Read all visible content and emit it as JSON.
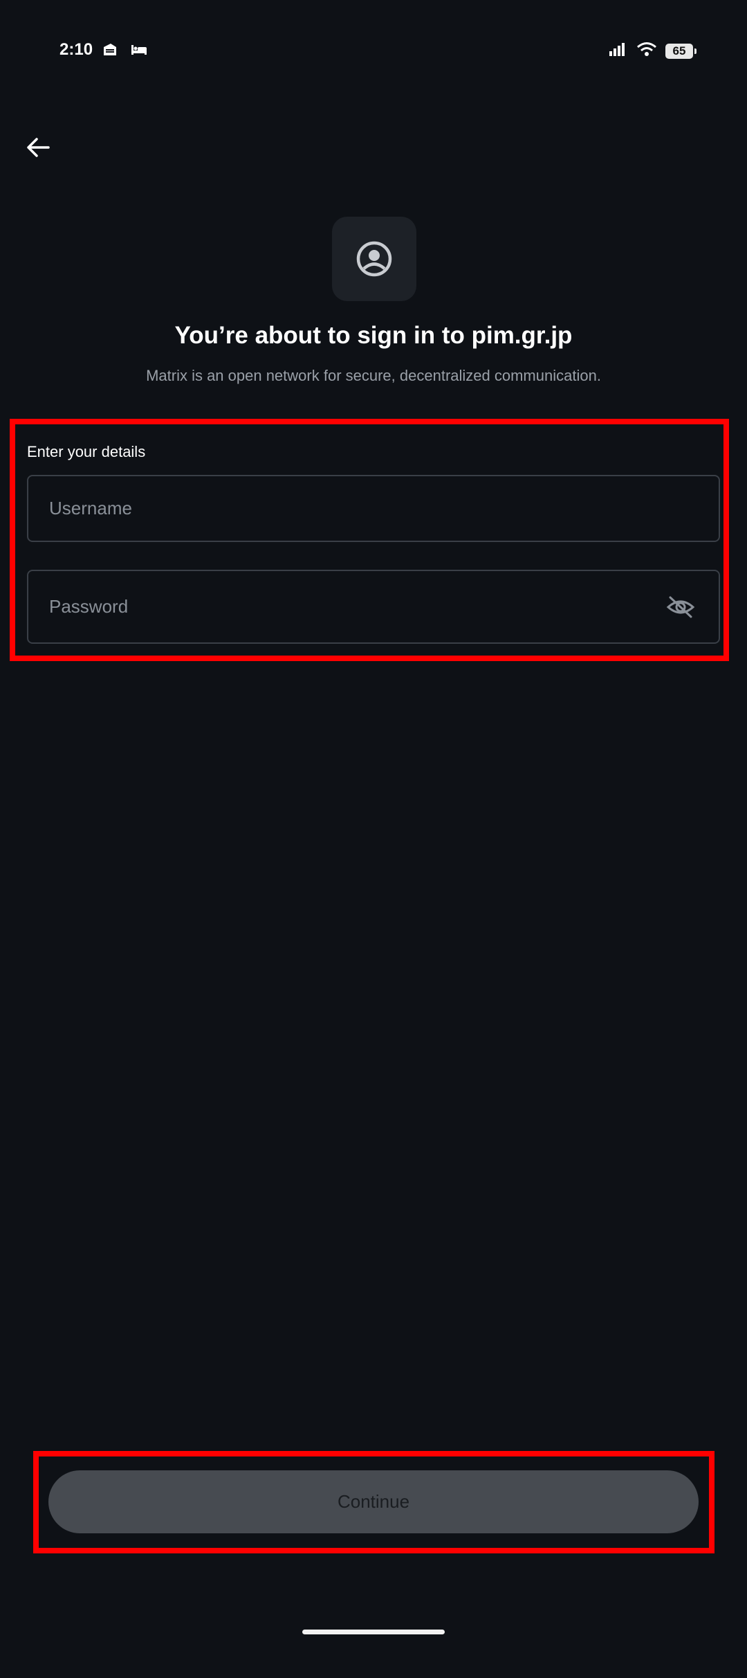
{
  "status_bar": {
    "time": "2:10",
    "battery": "65"
  },
  "header": {
    "title": "You’re about to sign in to pim.gr.jp",
    "subtitle": "Matrix is an open network for secure, decentralized communication."
  },
  "form": {
    "label": "Enter your details",
    "username_placeholder": "Username",
    "password_placeholder": "Password"
  },
  "actions": {
    "continue_label": "Continue"
  },
  "colors": {
    "background": "#0e1116",
    "highlight": "#ff0000",
    "button_disabled": "#474b51"
  }
}
